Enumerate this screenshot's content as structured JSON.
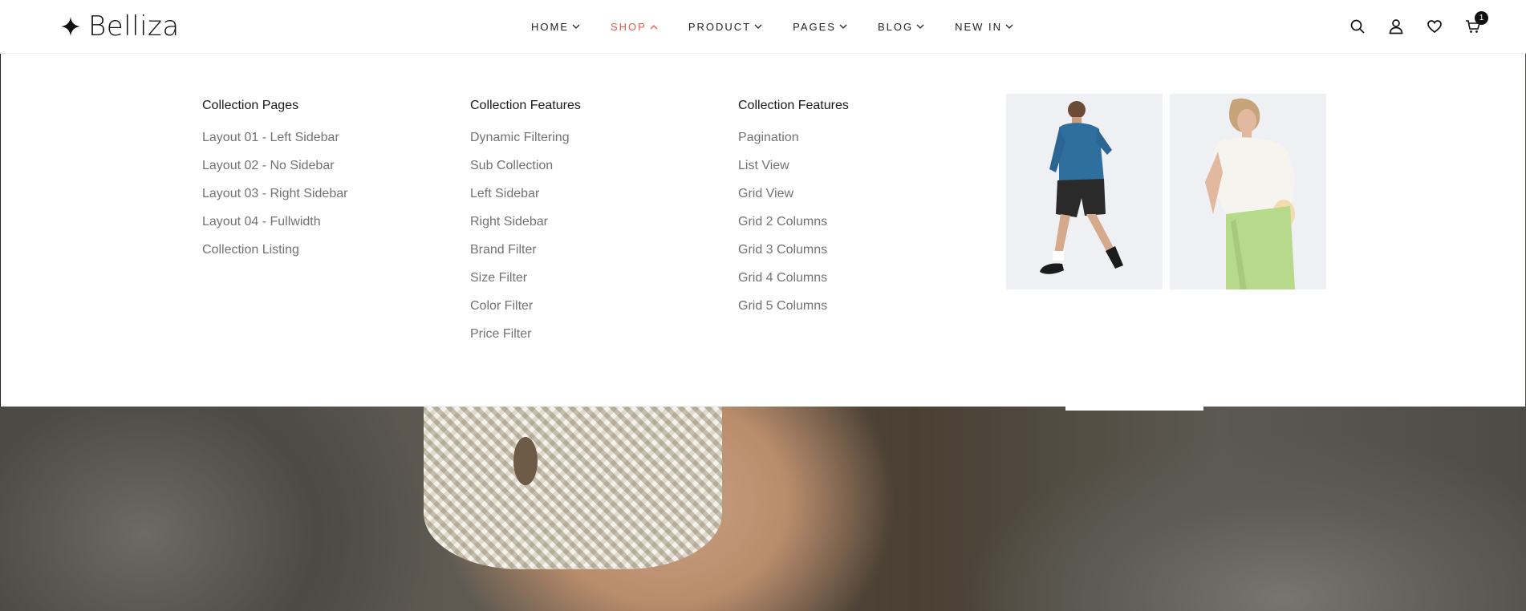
{
  "brand": {
    "name": "Belliza"
  },
  "nav": {
    "items": [
      {
        "label": "HOME",
        "active": false
      },
      {
        "label": "SHOP",
        "active": true
      },
      {
        "label": "PRODUCT",
        "active": false
      },
      {
        "label": "PAGES",
        "active": false
      },
      {
        "label": "BLOG",
        "active": false
      },
      {
        "label": "NEW IN",
        "active": false
      }
    ]
  },
  "header_icons": {
    "search": "search-icon",
    "account": "user-icon",
    "wishlist": "heart-icon",
    "cart": "cart-icon",
    "cart_count": "1"
  },
  "mega_menu": {
    "columns": [
      {
        "title": "Collection Pages",
        "links": [
          "Layout 01 - Left Sidebar",
          "Layout 02 - No Sidebar",
          "Layout 03 - Right Sidebar",
          "Layout 04 - Fullwidth",
          "Collection Listing"
        ]
      },
      {
        "title": "Collection Features",
        "links": [
          "Dynamic Filtering",
          "Sub Collection",
          "Left Sidebar",
          "Right Sidebar",
          "Brand Filter",
          "Size Filter",
          "Color Filter",
          "Price Filter"
        ]
      },
      {
        "title": "Collection Features",
        "links": [
          "Pagination",
          "List View",
          "Grid View",
          "Grid 2 Columns",
          "Grid 3 Columns",
          "Grid 4 Columns",
          "Grid 5 Columns"
        ]
      }
    ]
  },
  "colors": {
    "accent": "#e05a4f",
    "text": "#222222",
    "link": "#727272"
  }
}
